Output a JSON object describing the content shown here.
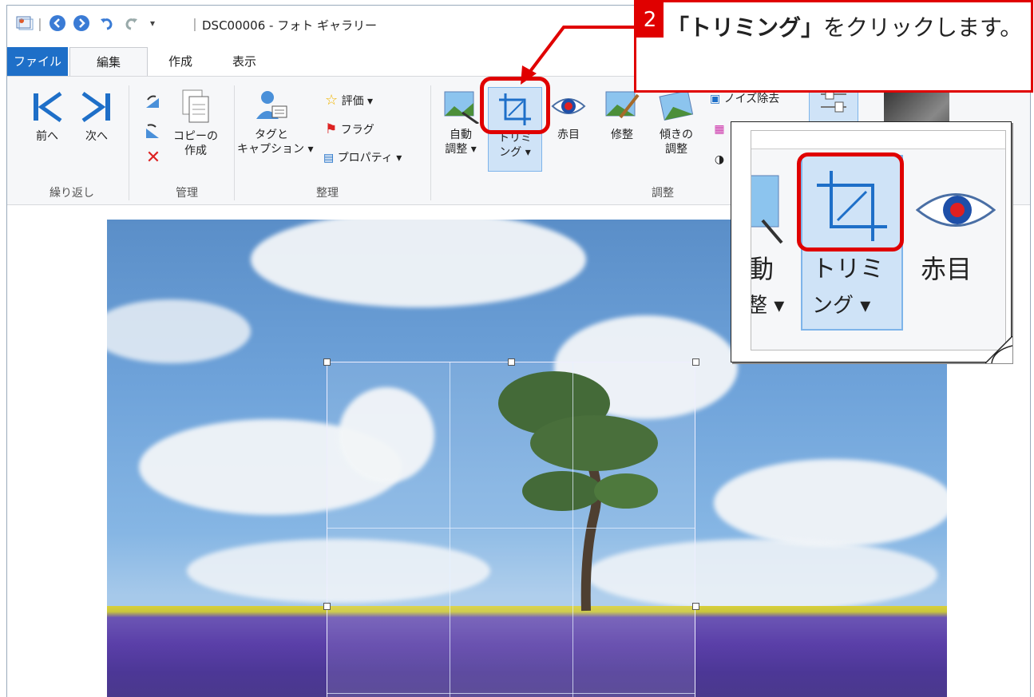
{
  "window": {
    "title": "DSC00006 - フォト ギャラリー"
  },
  "quick_access": {
    "icons": [
      "app-icon",
      "back-icon",
      "forward-icon",
      "undo-icon",
      "redo-icon",
      "customize-icon"
    ]
  },
  "tabs": [
    "ファイル",
    "編集",
    "作成",
    "表示"
  ],
  "ribbon": {
    "groups": {
      "repeat": {
        "label": "繰り返し",
        "prev": "前へ",
        "next": "次へ"
      },
      "manage": {
        "label": "管理",
        "copy_line1": "コピーの",
        "copy_line2": "作成"
      },
      "organize": {
        "label": "整理",
        "tag_line1": "タグと",
        "tag_line2": "キャプション ▾",
        "rating": "評価 ▾",
        "flag": "フラグ",
        "properties": "プロパティ ▾"
      },
      "adjust": {
        "label": "調整",
        "auto_line1": "自動",
        "auto_line2": "調整 ▾",
        "crop_line1": "トリミ",
        "crop_line2": "ング ▾",
        "redeye": "赤目",
        "retouch": "修整",
        "straighten_line1": "傾きの",
        "straighten_line2": "調整",
        "noise": "ノイズ除去"
      }
    }
  },
  "callout": {
    "step": "2",
    "text_bold": "「トリミング」",
    "text_rest": "をクリックします。"
  },
  "zoom": {
    "auto_partial": "動",
    "auto_partial2": "整 ▾",
    "crop_line1": "トリミ",
    "crop_line2": "ング ▾",
    "redeye": "赤目"
  },
  "colors": {
    "accent": "#1e6fc8",
    "highlight": "#e00000",
    "crop_button_bg": "#cfe3f7"
  }
}
